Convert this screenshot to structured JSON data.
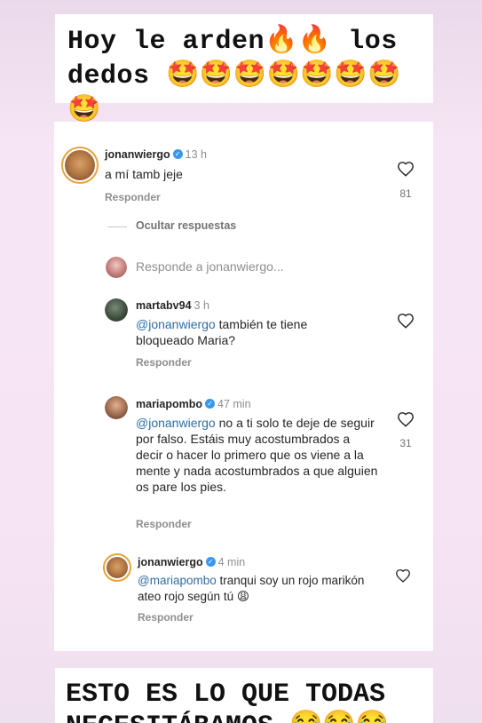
{
  "captions": {
    "top_line1": "Hoy le arden🔥🔥 los",
    "top_line2": "dedos 🤩🤩🤩🤩🤩🤩🤩🤩",
    "bottom_line1": "ESTO ES LO QUE TODAS",
    "bottom_line2": "NECESITÁBAMOS 😂😂😂"
  },
  "comment_main": {
    "username": "jonanwiergo",
    "time": "13 h",
    "text": "a mí tamb jeje",
    "reply_label": "Responder",
    "likes": "81"
  },
  "thread": {
    "hide_label": "Ocultar respuestas",
    "reply_placeholder": "Responde a jonanwiergo..."
  },
  "replies": [
    {
      "username": "martabv94",
      "time": "3 h",
      "mention": "@jonanwiergo",
      "text": " también te tiene bloqueado Maria?",
      "reply_label": "Responder",
      "likes": ""
    },
    {
      "username": "mariapombo",
      "time": "47 min",
      "mention": "@jonanwiergo",
      "text": " no a ti solo te deje de seguir por falso. Estáis muy acostumbrados a decir o hacer lo primero que os viene a la mente y nada acostumbrados a que alguien os pare los pies.",
      "reply_label": "Responder",
      "likes": "31"
    },
    {
      "username": "jonanwiergo",
      "time": "4 min",
      "mention": "@mariapombo",
      "text": " tranqui soy un rojo marikón ateo rojo según tú 😩",
      "reply_label": "Responder",
      "likes": ""
    }
  ],
  "colors": {
    "mention": "#2e6da4",
    "verified": "#3897f0",
    "story_background": "#f6e6f4"
  }
}
